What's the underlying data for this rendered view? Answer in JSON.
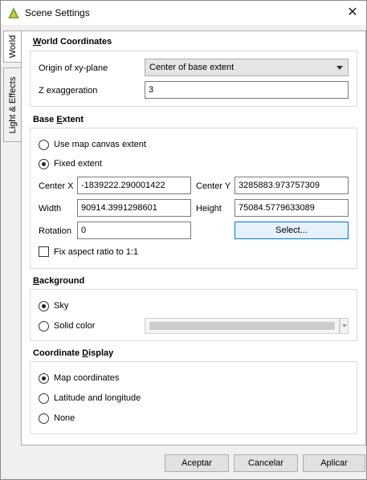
{
  "window": {
    "title": "Scene Settings"
  },
  "tabs": [
    {
      "label": "World"
    },
    {
      "label": "Light & Effects"
    }
  ],
  "world_coordinates": {
    "title_prefix": "W",
    "title_rest": "orld Coordinates",
    "origin_label": "Origin of xy-plane",
    "origin_value": "Center of base extent",
    "z_label": "Z exaggeration",
    "z_value": "3"
  },
  "base_extent": {
    "title_before": "Base ",
    "title_underline": "E",
    "title_after": "xtent",
    "use_map_canvas_label": "Use map canvas extent",
    "fixed_extent_label": "Fixed extent",
    "selected": "fixed",
    "center_x_label": "Center X",
    "center_x_value": "-1839222.290001422",
    "center_y_label": "Center Y",
    "center_y_value": "3285883.973757309",
    "width_label": "Width",
    "width_value": "90914.3991298601",
    "height_label": "Height",
    "height_value": "75084.5779633089",
    "rotation_label": "Rotation",
    "rotation_value": "0",
    "select_button": "Select...",
    "fix_aspect_label": "Fix aspect ratio to 1:1",
    "fix_aspect_checked": false
  },
  "background": {
    "title_prefix": "B",
    "title_rest": "ackground",
    "sky_label": "Sky",
    "solid_color_label": "Solid color",
    "selected": "sky",
    "swatch_color": "#cccccc"
  },
  "coordinate_display": {
    "title_before": "Coordinate ",
    "title_underline": "D",
    "title_after": "isplay",
    "map_coords_label": "Map coordinates",
    "lat_long_label": "Latitude and longitude",
    "none_label": "None",
    "selected": "map"
  },
  "footer": {
    "accept": "Aceptar",
    "cancel": "Cancelar",
    "apply": "Aplicar"
  },
  "colors": {
    "accent": "#0078d7",
    "icon_green": "#6fb43f",
    "icon_yellow": "#e8c43a"
  }
}
